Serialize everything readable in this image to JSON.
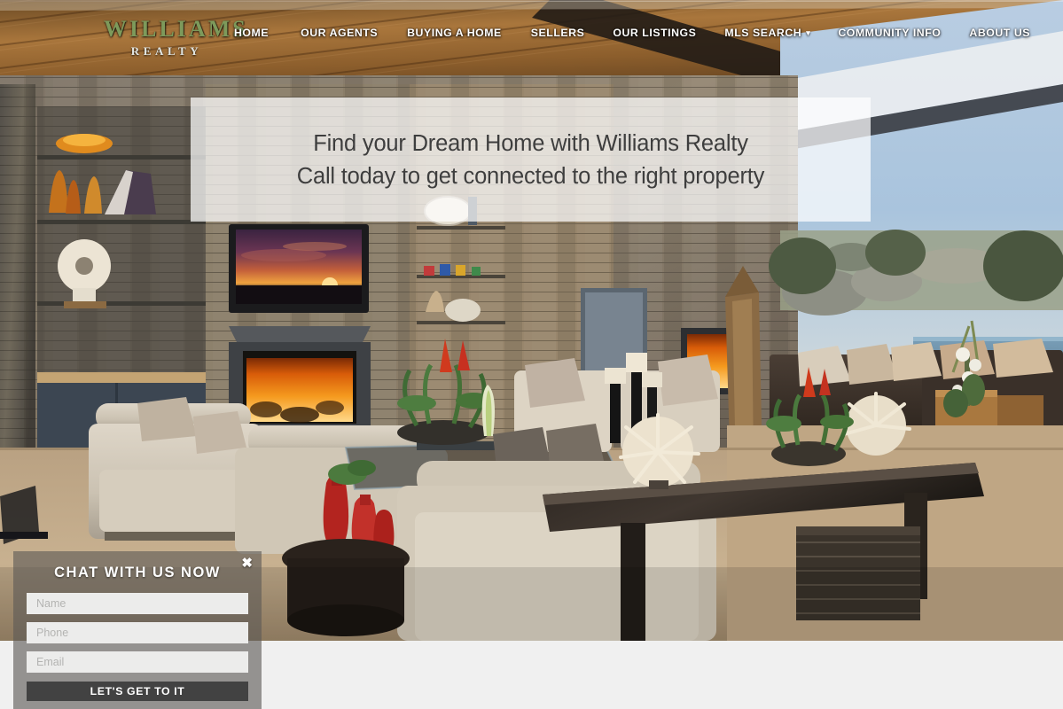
{
  "site": {
    "logo_main": "WILLIAMS",
    "logo_sub": "REALTY",
    "logo_color": "#7d9a5b"
  },
  "nav": {
    "items": [
      {
        "label": "HOME",
        "has_dropdown": false
      },
      {
        "label": "OUR AGENTS",
        "has_dropdown": false
      },
      {
        "label": "BUYING A HOME",
        "has_dropdown": false
      },
      {
        "label": "SELLERS",
        "has_dropdown": false
      },
      {
        "label": "OUR LISTINGS",
        "has_dropdown": false
      },
      {
        "label": "MLS SEARCH",
        "has_dropdown": true,
        "chevron": "▾"
      },
      {
        "label": "COMMUNITY INFO",
        "has_dropdown": false
      },
      {
        "label": "ABOUT US",
        "has_dropdown": false
      }
    ]
  },
  "hero": {
    "headline_line1": "Find your Dream Home with Williams Realty",
    "headline_line2": "Call today to get connected to the right property",
    "panel_color": "#ffffff",
    "text_color": "#3e3e3e",
    "image_alt": "Luxury desert living room with stone fireplace, wall-mounted TV showing a sunset, cream sofas and armchairs, wooden ceiling, and open patio with wicker furniture and a pool"
  },
  "chat": {
    "title": "CHAT WITH US NOW",
    "close_label": "✖",
    "fields": [
      {
        "name": "name",
        "placeholder": "Name",
        "value": ""
      },
      {
        "name": "phone",
        "placeholder": "Phone",
        "value": ""
      },
      {
        "name": "email",
        "placeholder": "Email",
        "value": ""
      }
    ],
    "submit_label": "LET'S GET TO IT",
    "submit_color": "#424242"
  }
}
